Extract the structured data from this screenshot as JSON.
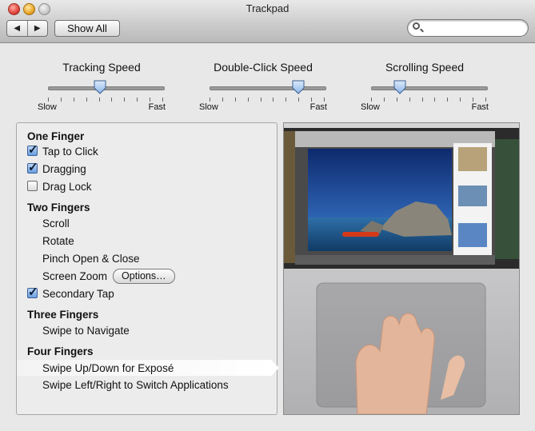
{
  "window": {
    "title": "Trackpad"
  },
  "toolbar": {
    "back_glyph": "◀",
    "forward_glyph": "▶",
    "show_all_label": "Show All",
    "search_placeholder": "",
    "search_value": ""
  },
  "sliders": [
    {
      "title": "Tracking Speed",
      "min_label": "Slow",
      "max_label": "Fast",
      "value": 0.45
    },
    {
      "title": "Double-Click Speed",
      "min_label": "Slow",
      "max_label": "Fast",
      "value": 0.77
    },
    {
      "title": "Scrolling Speed",
      "min_label": "Slow",
      "max_label": "Fast",
      "value": 0.25
    }
  ],
  "gestures": {
    "one_finger": {
      "header": "One Finger",
      "tap_to_click": {
        "label": "Tap to Click",
        "checked": true
      },
      "dragging": {
        "label": "Dragging",
        "checked": true
      },
      "drag_lock": {
        "label": "Drag Lock",
        "checked": false
      }
    },
    "two_fingers": {
      "header": "Two Fingers",
      "scroll": "Scroll",
      "rotate": "Rotate",
      "pinch": "Pinch Open & Close",
      "screen_zoom": "Screen Zoom",
      "options_label": "Options…",
      "secondary_tap": {
        "label": "Secondary Tap",
        "checked": true
      }
    },
    "three_fingers": {
      "header": "Three Fingers",
      "swipe_navigate": "Swipe to Navigate"
    },
    "four_fingers": {
      "header": "Four Fingers",
      "swipe_updown": "Swipe Up/Down for Exposé",
      "swipe_leftright": "Swipe Left/Right to Switch Applications"
    }
  },
  "colors": {
    "checkbox_on": "#6a9fe0",
    "slider_knob": "#8fb6e8",
    "preview_trackpad": "#b9b9bb"
  }
}
